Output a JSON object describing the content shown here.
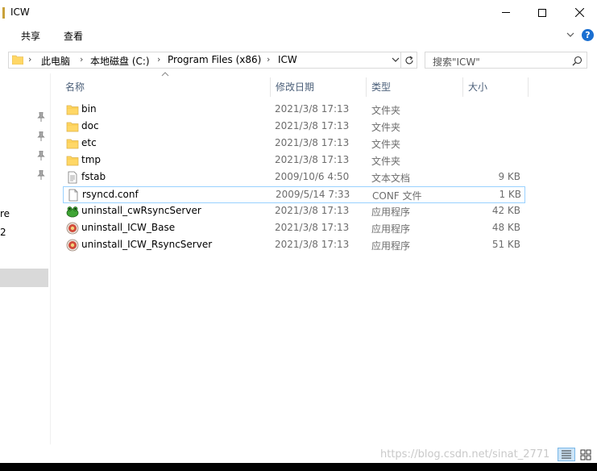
{
  "window": {
    "title": "ICW"
  },
  "ribbon": {
    "tabs": [
      "共享",
      "查看"
    ]
  },
  "address": {
    "breadcrumbs": [
      "此电脑",
      "本地磁盘 (C:)",
      "Program Files (x86)",
      "ICW"
    ],
    "separator": "›"
  },
  "search": {
    "placeholder": "搜索\"ICW\""
  },
  "nav": {
    "partial_items": [
      "re",
      "2"
    ]
  },
  "columns": {
    "name": "名称",
    "date": "修改日期",
    "type": "类型",
    "size": "大小"
  },
  "files": [
    {
      "name": "bin",
      "date": "2021/3/8 17:13",
      "type": "文件夹",
      "size": "",
      "icon": "folder-icon"
    },
    {
      "name": "doc",
      "date": "2021/3/8 17:13",
      "type": "文件夹",
      "size": "",
      "icon": "folder-icon"
    },
    {
      "name": "etc",
      "date": "2021/3/8 17:13",
      "type": "文件夹",
      "size": "",
      "icon": "folder-icon"
    },
    {
      "name": "tmp",
      "date": "2021/3/8 17:13",
      "type": "文件夹",
      "size": "",
      "icon": "folder-icon"
    },
    {
      "name": "fstab",
      "date": "2009/10/6 4:50",
      "type": "文本文档",
      "size": "9 KB",
      "icon": "text-file-icon"
    },
    {
      "name": "rsyncd.conf",
      "date": "2009/5/14 7:33",
      "type": "CONF 文件",
      "size": "1 KB",
      "icon": "file-icon"
    },
    {
      "name": "uninstall_cwRsyncServer",
      "date": "2021/3/8 17:13",
      "type": "应用程序",
      "size": "42 KB",
      "icon": "frog-app-icon"
    },
    {
      "name": "uninstall_ICW_Base",
      "date": "2021/3/8 17:13",
      "type": "应用程序",
      "size": "48 KB",
      "icon": "installer-app-icon"
    },
    {
      "name": "uninstall_ICW_RsyncServer",
      "date": "2021/3/8 17:13",
      "type": "应用程序",
      "size": "51 KB",
      "icon": "installer-app-icon"
    }
  ],
  "selected_index": 5,
  "watermark": "https://blog.csdn.net/sinat_2771",
  "colors": {
    "folder": "#ffd766",
    "selection_border": "#99d1ff",
    "header_text": "#4c607a",
    "accent": "#1a6fd1"
  }
}
